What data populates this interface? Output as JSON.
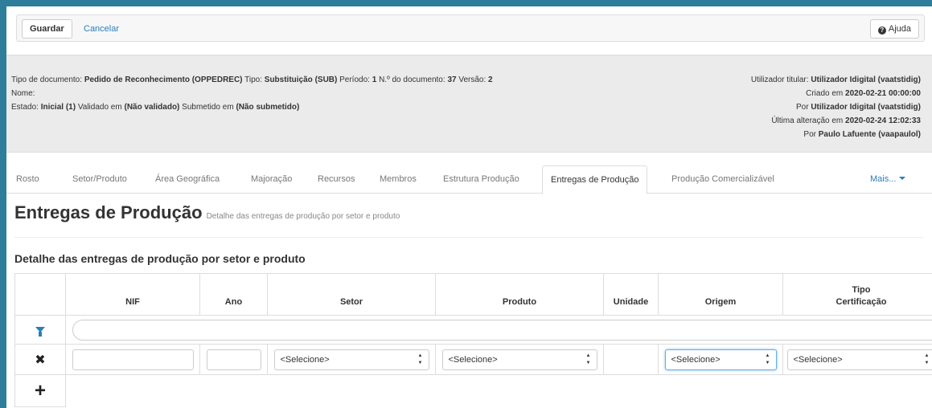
{
  "toolbar": {
    "save_label": "Guardar",
    "cancel_label": "Cancelar",
    "help_label": "Ajuda"
  },
  "document_info": {
    "doc_type_label": "Tipo de documento:",
    "doc_type_value": "Pedido de Reconhecimento (OPPEDREC)",
    "type_label": "Tipo:",
    "type_value": "Substituição (SUB)",
    "period_label": "Período:",
    "period_value": "1",
    "doc_number_label": "N.º do documento:",
    "doc_number_value": "37",
    "version_label": "Versão:",
    "version_value": "2",
    "name_label": "Nome:",
    "state_label": "Estado:",
    "state_value": "Inicial (1)",
    "validated_label": "Validado em",
    "validated_value": "(Não validado)",
    "submitted_label": "Submetido em",
    "submitted_value": "(Não submetido)",
    "holder_label": "Utilizador titular:",
    "holder_value": "Utilizador Idigital (vaatstidig)",
    "created_label": "Criado em",
    "created_value": "2020-02-21 00:00:00",
    "created_by_label": "Por",
    "created_by_value": "Utilizador Idigital (vaatstidig)",
    "last_change_label": "Última alteração em",
    "last_change_value": "2020-02-24 12:02:33",
    "changed_by_label": "Por",
    "changed_by_value": "Paulo Lafuente (vaapaulol)"
  },
  "tabs": [
    {
      "label": "Rosto"
    },
    {
      "label": "Setor/Produto"
    },
    {
      "label": "Área Geográfica"
    },
    {
      "label": "Majoração"
    },
    {
      "label": "Recursos"
    },
    {
      "label": "Membros"
    },
    {
      "label": "Estrutura Produção"
    },
    {
      "label": "Entregas de Produção"
    },
    {
      "label": "Produção Comercializável"
    },
    {
      "label": "Mais..."
    }
  ],
  "page": {
    "title": "Entregas de Produção",
    "subtitle": "Detalhe das entregas de produção por setor e produto",
    "section_title": "Detalhe das entregas de produção por setor e produto"
  },
  "table": {
    "columns": [
      "NIF",
      "Ano",
      "Setor",
      "Produto",
      "Unidade",
      "Origem",
      "Tipo",
      "Certificação"
    ],
    "select_placeholder": "<Selecione>"
  },
  "colors": {
    "frame": "#2e7d9a",
    "link": "#2a7fb8",
    "info_background": "#ebebeb"
  },
  "icons": [
    "help-icon",
    "filter-icon",
    "close-icon",
    "plus-icon",
    "chevron-down-icon"
  ]
}
